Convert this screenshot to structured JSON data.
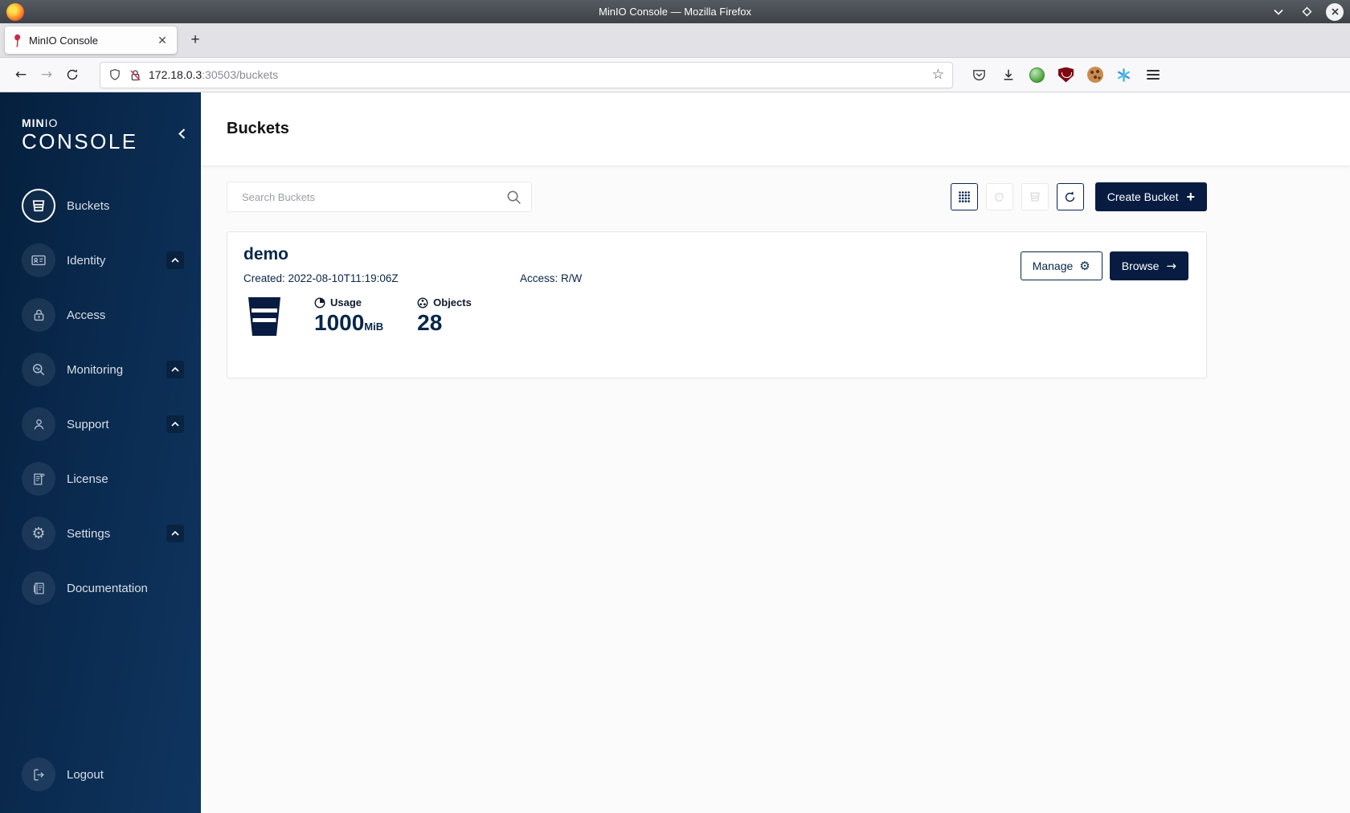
{
  "window": {
    "title": "MinIO Console — Mozilla Firefox"
  },
  "browser": {
    "tab_title": "MinIO Console",
    "url_host": "172.18.0.3",
    "url_rest": ":30503/buckets"
  },
  "icons": {
    "back": "←",
    "forward": "→",
    "star": "☆",
    "tab_close": "✕",
    "new_tab": "+",
    "gear": "⚙",
    "arrow_right": "→",
    "create_plus": "+"
  },
  "sidebar": {
    "logo": {
      "brand_bold": "MIN",
      "brand_light": "IO",
      "product": "CONSOLE"
    },
    "items": [
      {
        "label": "Buckets",
        "active": true,
        "expandable": false
      },
      {
        "label": "Identity",
        "active": false,
        "expandable": true
      },
      {
        "label": "Access",
        "active": false,
        "expandable": false
      },
      {
        "label": "Monitoring",
        "active": false,
        "expandable": true
      },
      {
        "label": "Support",
        "active": false,
        "expandable": true
      },
      {
        "label": "License",
        "active": false,
        "expandable": false
      },
      {
        "label": "Settings",
        "active": false,
        "expandable": true
      },
      {
        "label": "Documentation",
        "active": false,
        "expandable": false
      }
    ],
    "logout_label": "Logout"
  },
  "page": {
    "title": "Buckets",
    "search_placeholder": "Search Buckets",
    "create_button_label": "Create Bucket",
    "bucket": {
      "name": "demo",
      "created": "Created: 2022-08-10T11:19:06Z",
      "access": "Access: R/W",
      "manage_label": "Manage",
      "browse_label": "Browse",
      "usage_label": "Usage",
      "usage_value": "1000",
      "usage_unit": "MiB",
      "objects_label": "Objects",
      "objects_value": "28"
    }
  }
}
